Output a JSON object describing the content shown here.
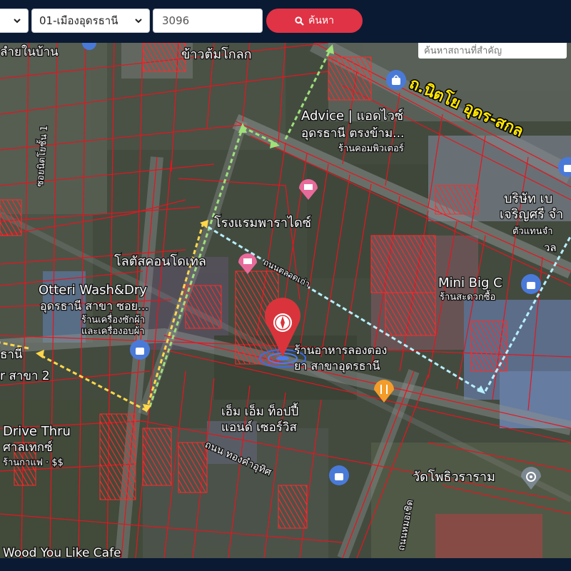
{
  "toolbar": {
    "province_select_value": "",
    "district_select_value": "01-เมืองอุดรธานี",
    "parcel_code_value": "3096",
    "search_button_label": "ค้นหา"
  },
  "map": {
    "place_search_placeholder": "ค้นหาสถานที่สำคัญ",
    "labels": {
      "top_left_fragment": "ลำยในบ้าน",
      "rice_soup": "ข้าวต้มโกลก",
      "road_nittayo": "ถ.นิตโย อุดร-สกล",
      "advice_line1": "Advice | แอดไวซ์",
      "advice_line2": "อุดรธานี ตรงข้าม...",
      "advice_line3": "ร้านคอมพิวเตอร์",
      "soi_left": "ซอยนิตโยชั้น 1",
      "paradise_hotel": "โรงแรมพาราไดซ์",
      "company_line1": "บริษัท เบ",
      "company_line2": "เจริญศรี จำ",
      "company_line3": "ตัวแทนจำ",
      "company_line4": "วล",
      "condotel": "โลตัสคอนโดเทล",
      "otteri_line1": "Otteri Wash&Dry",
      "otteri_line2": "อุดรธานี สาขา ซอย...",
      "otteri_line3": "ร้านเครื่องซักผ้า",
      "otteri_line4": "และเครื่องอบผ้า",
      "road_diag": "ถนนตลาดเก่า",
      "mini_bigc": "Mini Big C",
      "mini_bigc_sub": "ร้านสะดวกซื้อ",
      "restaurant_line1": "ร้านอาหารลองตอง",
      "restaurant_line2": "ยา สาขาอุดรธานี",
      "left_line1": "ธานี",
      "left_line2": "r สาขา 2",
      "mm_line1": "เอ็ม เอ็ม ท็อปปี้",
      "mm_line2": "แอนด์ เซอร์วิส",
      "drive_thru_line1": "Drive Thru",
      "drive_thru_line2": "ศาลเทกซ์",
      "drive_thru_line3": "ร้านกาแฟ · $$",
      "road_bottom": "ถนน ทองคำอุทิศ",
      "temple": "วัดโพธิวราราม",
      "road_right": "ถนนหมอเชิด",
      "wood_cafe": "Wood You Like Cafe"
    }
  },
  "colors": {
    "header_bg": "#0b1a33",
    "search_button": "#e03345",
    "parcel_lines": "#e8141e",
    "road_label_yellow": "#ffe600",
    "route_arrow_green": "#9fe07a",
    "route_arrow_cyan": "#b8f0ff",
    "route_arrow_yellow": "#ffd84a",
    "pin": "#d9343b"
  },
  "icons": [
    "search-icon",
    "chevron-down-icon",
    "location-pin-icon",
    "shopping-bag-icon",
    "hotel-icon",
    "restaurant-icon",
    "temple-icon"
  ]
}
